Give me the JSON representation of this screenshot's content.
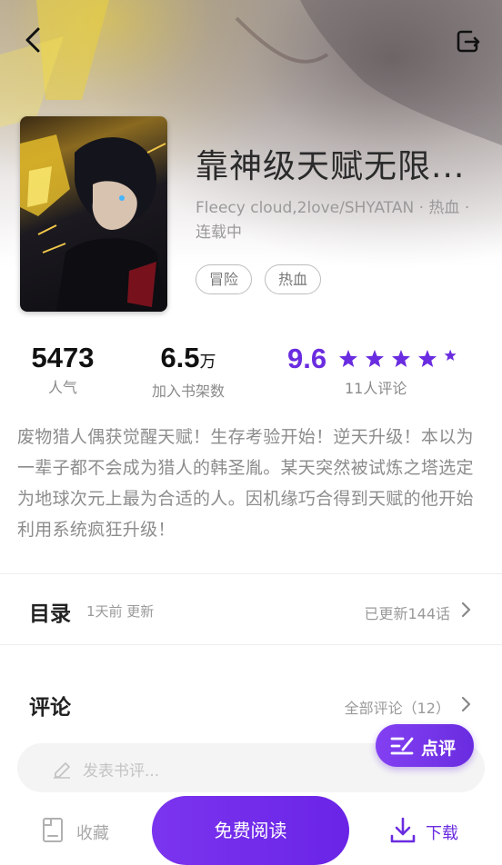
{
  "header": {
    "back_icon": "chevron-left-icon",
    "share_icon": "share-exit-icon"
  },
  "book": {
    "title": "靠神级天赋无限...",
    "meta": "Fleecy cloud,2love/SHYATAN · 热血 · 连载中",
    "tags": [
      "冒险",
      "热血"
    ]
  },
  "stats": {
    "popularity": {
      "value": "5473",
      "label": "人气"
    },
    "shelf": {
      "value": "6.5",
      "unit": "万",
      "label": "加入书架数"
    },
    "rating": {
      "value": "9.6",
      "stars": 5,
      "label": "11人评论",
      "accent": "#6a2ce0"
    }
  },
  "description": "废物猎人偶获觉醒天赋！生存考验开始！逆天升级！本以为一辈子都不会成为猎人的韩圣胤。某天突然被试炼之塔选定为地球次元上最为合适的人。因机缘巧合得到天赋的他开始利用系统疯狂升级！",
  "catalog": {
    "title": "目录",
    "update_time": "1天前 更新",
    "update_count": "已更新144话"
  },
  "comments": {
    "title": "评论",
    "all_label": "全部评论（12）",
    "input_placeholder": "发表书评...",
    "rate_label": "点评"
  },
  "bottom": {
    "favorite_label": "收藏",
    "read_label": "免费阅读",
    "download_label": "下载"
  },
  "colors": {
    "accent": "#6a2ce0",
    "text_muted": "#9a9a9a"
  }
}
